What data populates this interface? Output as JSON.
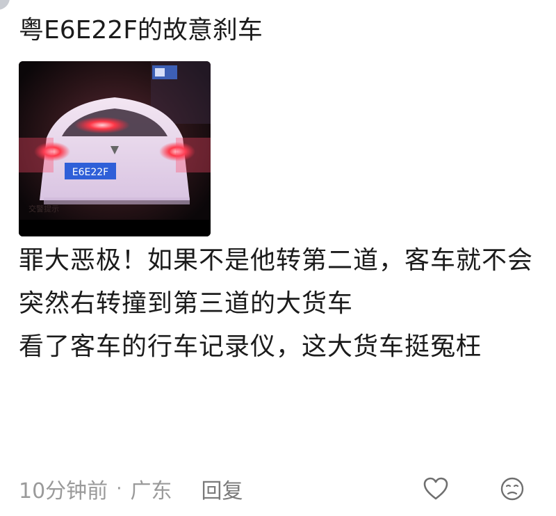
{
  "comment": {
    "title": "粤E6E22F的故意刹车",
    "image": {
      "plate_text": "E6E22F",
      "watermark": "交警提示"
    },
    "paragraphs": [
      "罪大恶极！如果不是他转第二道，客车就不会突然右转撞到第三道的大货车",
      "看了客车的行车记录仪，这大货车挺冤枉"
    ]
  },
  "meta": {
    "time": "10分钟前",
    "separator": "·",
    "location": "广东",
    "reply_label": "回复"
  },
  "icons": {
    "like": "heart-outline-icon",
    "emoji": "emoji-face-icon"
  },
  "colors": {
    "text": "#1b1b1b",
    "meta": "#9a9a9a",
    "taillight": "#ff2a3a"
  }
}
